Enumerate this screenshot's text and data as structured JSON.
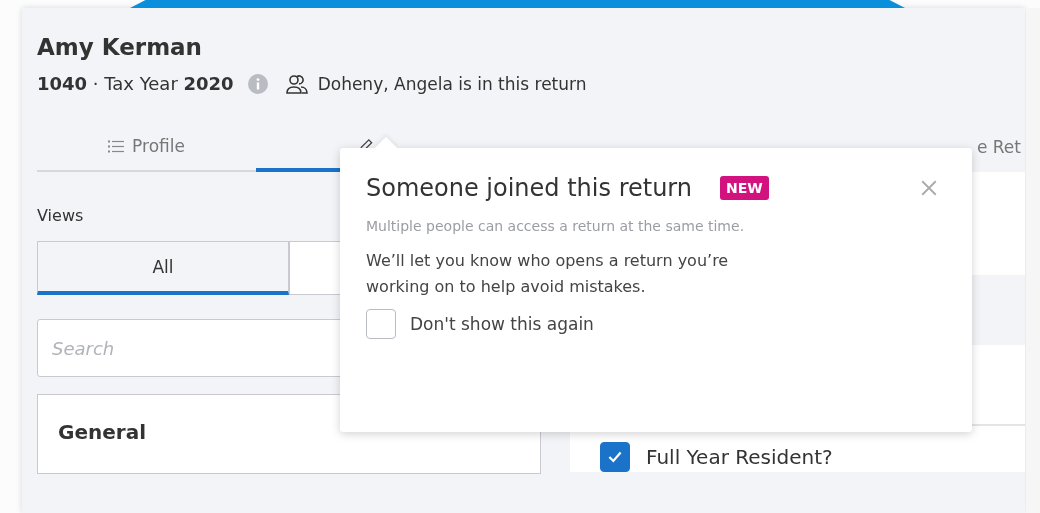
{
  "client": {
    "name": "Amy Kerman",
    "form": "1040",
    "separator": "·",
    "year_label": "Tax Year",
    "year": "2020",
    "presence": "Doheny, Angela is in this return"
  },
  "tabs": [
    {
      "label": "Profile",
      "kind": "list",
      "selected": false
    },
    {
      "kind": "edit",
      "selected": true
    },
    {
      "label": "e Ret",
      "selected": false
    }
  ],
  "views": {
    "label": "Views",
    "segments": [
      {
        "label": "All",
        "selected": true
      },
      {
        "selected": false
      }
    ]
  },
  "search": {
    "placeholder": "Search"
  },
  "sections": [
    {
      "title": "General"
    }
  ],
  "form": {
    "fields": [
      {
        "label": "Full Year Resident?",
        "checked": true
      }
    ]
  },
  "popover": {
    "title": "Someone joined this return",
    "badge": "NEW",
    "subtitle": "Multiple people can access a return at the same time.",
    "body": "We’ll let you know who opens a return you’re working on to help avoid mistakes.",
    "checkbox": {
      "label": "Don't show this again",
      "checked": false
    }
  }
}
